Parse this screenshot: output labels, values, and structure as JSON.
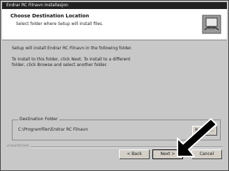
{
  "window": {
    "title": "Endrar RC Filnavn Installasjon"
  },
  "header": {
    "title": "Choose Destination Location",
    "subtitle": "Select folder where Setup will install files."
  },
  "body": {
    "line1": "Setup will install Endrar RC Filnavn in the following folder.",
    "line2a": "To install to this folder, click Next. To install to a different",
    "line2b": "folder, click Browse and select another folder."
  },
  "destination": {
    "group_label": "Destination Folder",
    "path": "C:\\Programfiler\\Endrar RC Filnavn",
    "browse_label": "Browse..."
  },
  "footer": {
    "brand": "InstallShield",
    "back_label": "< Back",
    "next_label": "Next >",
    "cancel_label": "Cancel"
  },
  "icons": {
    "header": "setup-computer-icon",
    "pointer": "arrow-pointer-icon"
  }
}
